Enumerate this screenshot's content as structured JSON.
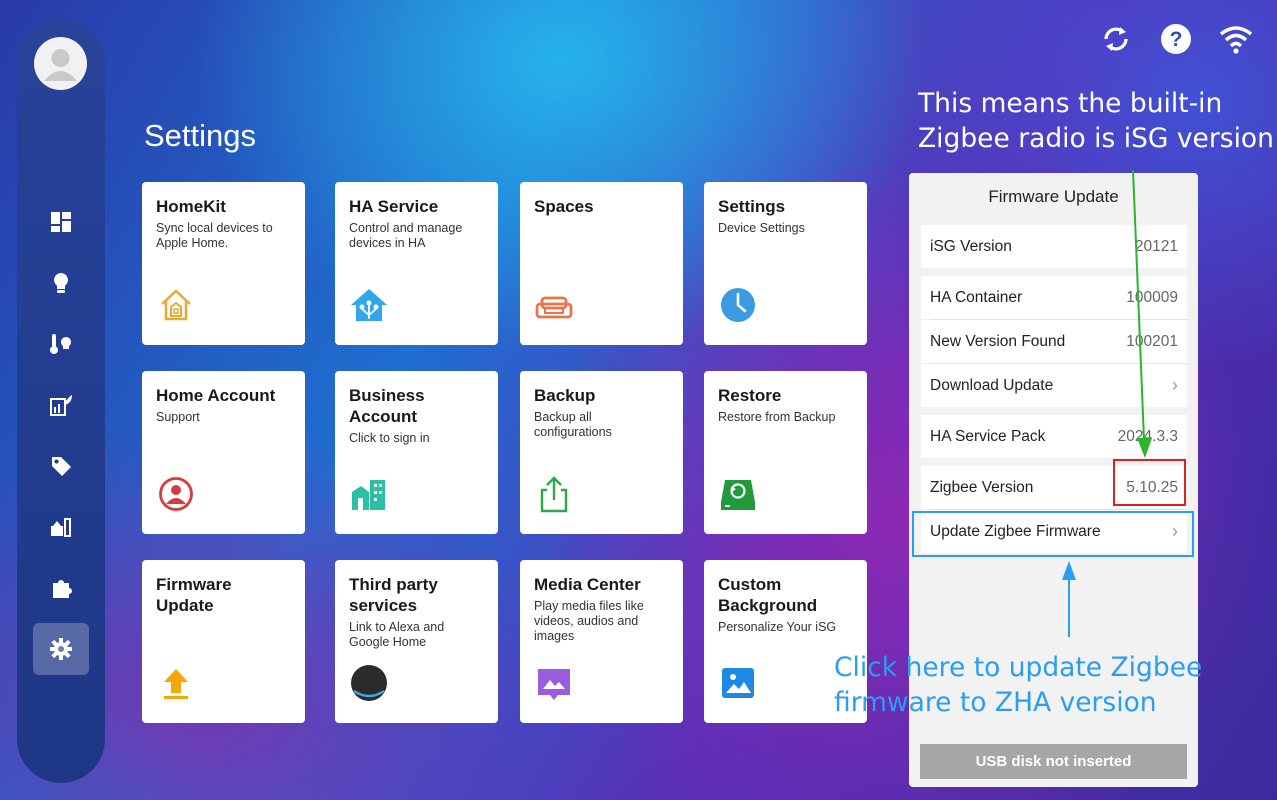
{
  "page_title": "Settings",
  "cards": [
    {
      "title": "HomeKit",
      "subtitle": "Sync local devices to Apple Home.",
      "icon": "house-icon"
    },
    {
      "title": "HA Service",
      "subtitle": "Control and manage devices in HA",
      "icon": "smart-home-icon"
    },
    {
      "title": "Spaces",
      "subtitle": "",
      "icon": "sofa-icon"
    },
    {
      "title": "Settings",
      "subtitle": "Device Settings",
      "icon": "clock-icon"
    },
    {
      "title": "Home Account",
      "subtitle": "Support",
      "icon": "user-circle-icon"
    },
    {
      "title": "Business Account",
      "subtitle": "Click to sign in",
      "icon": "buildings-icon"
    },
    {
      "title": "Backup",
      "subtitle": "Backup all configurations",
      "icon": "share-icon"
    },
    {
      "title": "Restore",
      "subtitle": "Restore from Backup",
      "icon": "restore-disk-icon"
    },
    {
      "title": "Firmware Update",
      "subtitle": "",
      "icon": "upload-arrow-icon"
    },
    {
      "title": "Third party services",
      "subtitle": "Link to Alexa and Google Home",
      "icon": "echo-dot-icon"
    },
    {
      "title": "Media Center",
      "subtitle": "Play media files like videos, audios and images",
      "icon": "media-icon"
    },
    {
      "title": "Custom Background",
      "subtitle": "Personalize Your iSG",
      "icon": "image-icon"
    }
  ],
  "firmware_panel": {
    "title": "Firmware Update",
    "isg_version_label": "iSG Version",
    "isg_version_value": "20121",
    "ha_container_label": "HA Container",
    "ha_container_value": "100009",
    "new_version_label": "New Version Found",
    "new_version_value": "100201",
    "download_update_label": "Download Update",
    "ha_service_pack_label": "HA Service Pack",
    "ha_service_pack_value": "2024.3.3",
    "zigbee_version_label": "Zigbee Version",
    "zigbee_version_value": "5.10.25",
    "update_zigbee_label": "Update Zigbee Firmware",
    "usb_button_label": "USB disk not inserted"
  },
  "annotations": {
    "top_line1": "This means the built-in",
    "top_line2": "Zigbee radio is iSG version",
    "bottom_line1": "Click here to update Zigbee",
    "bottom_line2": "firmware to ZHA version"
  },
  "colors": {
    "annotation_green": "#2bb52b",
    "annotation_blue": "#2a9df4",
    "highlight_red": "#e02020",
    "sidebar": "#1f3a8c"
  },
  "sidebar_icons": [
    "dashboard-icon",
    "bulb-icon",
    "thermometer-icon",
    "energy-icon",
    "tag-icon",
    "devices-icon",
    "puzzle-icon",
    "gear-icon"
  ],
  "top_icons": [
    "sync-icon",
    "help-icon",
    "wifi-icon"
  ]
}
